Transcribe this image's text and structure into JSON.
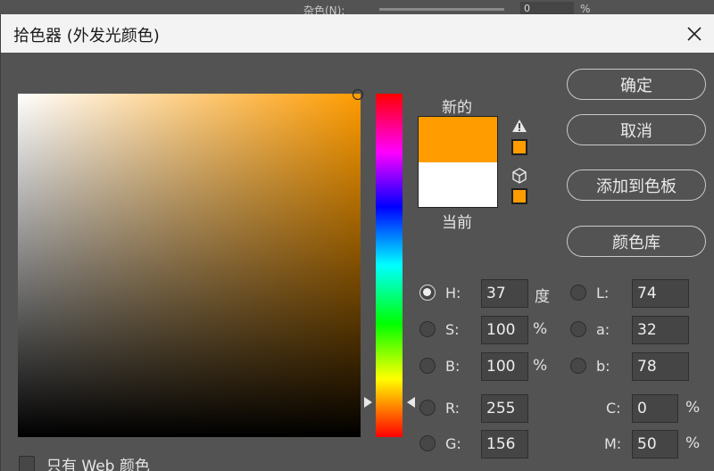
{
  "background": {
    "label": "杂色(N):",
    "input_value": "0",
    "unit": "%"
  },
  "dialog": {
    "title": "拾色器 (外发光颜色)"
  },
  "preview": {
    "new_label": "新的",
    "current_label": "当前",
    "new_color": "#ff9c00",
    "current_color": "#ffffff"
  },
  "buttons": {
    "ok": "确定",
    "cancel": "取消",
    "add_to_swatches": "添加到色板",
    "color_libraries": "颜色库"
  },
  "hsb": {
    "h_label": "H:",
    "h_value": "37",
    "h_unit": "度",
    "s_label": "S:",
    "s_value": "100",
    "s_unit": "%",
    "b_label": "B:",
    "b_value": "100",
    "b_unit": "%"
  },
  "lab": {
    "l_label": "L:",
    "l_value": "74",
    "a_label": "a:",
    "a_value": "32",
    "b_label": "b:",
    "b_value": "78"
  },
  "rgb": {
    "r_label": "R:",
    "r_value": "255",
    "g_label": "G:",
    "g_value": "156"
  },
  "cmyk": {
    "c_label": "C:",
    "c_value": "0",
    "c_unit": "%",
    "m_label": "M:",
    "m_value": "50",
    "m_unit": "%"
  },
  "web_only": {
    "label": "只有 Web 颜色"
  },
  "accent": "#ff9c00"
}
